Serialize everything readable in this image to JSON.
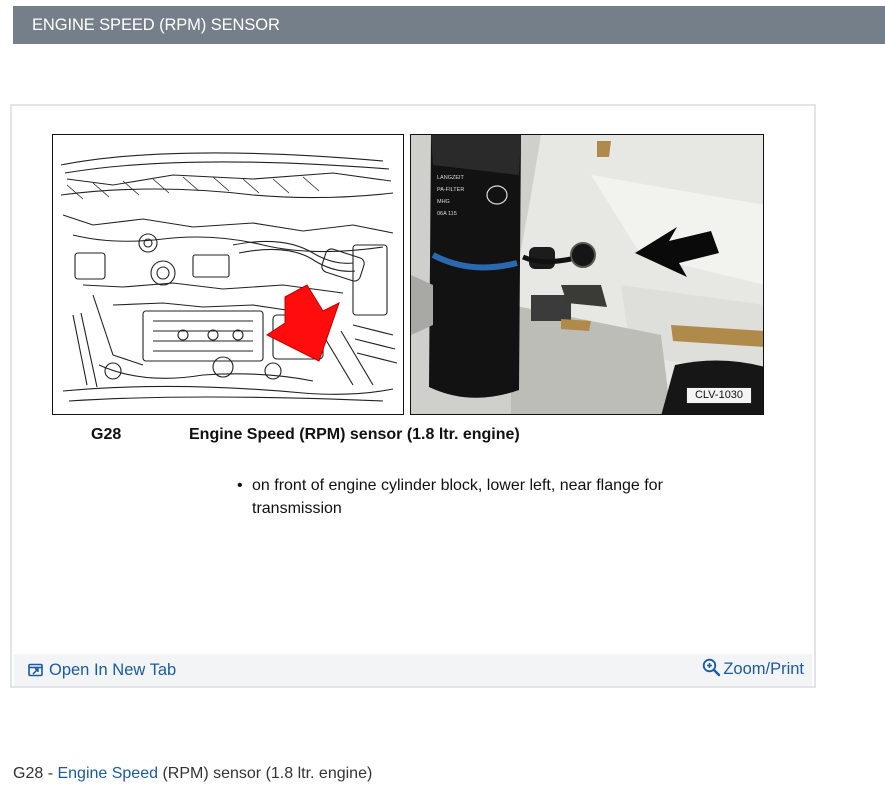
{
  "header": {
    "title": "ENGINE SPEED (RPM) SENSOR"
  },
  "diagram": {
    "photo_code": "CLV-1030",
    "part_code": "G28",
    "part_title": "Engine Speed (RPM) sensor (1.8 ltr. engine)",
    "bullet": "•",
    "location_note": "on front of engine cylinder block, lower left, near flange for transmission"
  },
  "actions": {
    "open_new_tab": "Open In New Tab",
    "zoom_print": "Zoom/Print"
  },
  "caption": {
    "prefix": "G28 - ",
    "link": "Engine Speed",
    "suffix": " (RPM) sensor (1.8 ltr. engine)"
  },
  "colors": {
    "header_bg": "#747f8a",
    "link": "#1a5aa6",
    "arrow_red": "#ff0d0d"
  }
}
